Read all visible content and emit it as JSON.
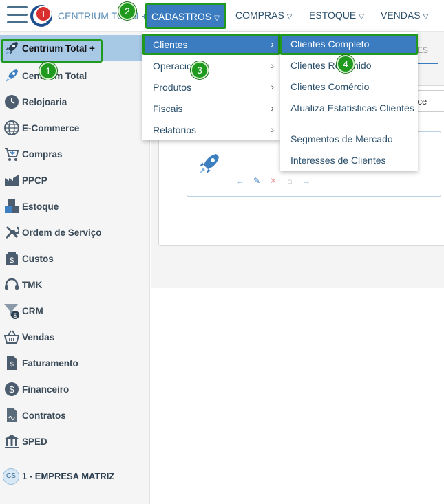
{
  "topbar": {
    "brand": "CENTRIUM TOTAL+",
    "logo_badge": "1",
    "menu": [
      {
        "label": "CADASTROS"
      },
      {
        "label": "COMPRAS"
      },
      {
        "label": "ESTOQUE"
      },
      {
        "label": "VENDAS"
      }
    ]
  },
  "sidebar": {
    "items": [
      {
        "label": "Centrium Total +",
        "icon": "rocket-tag-icon"
      },
      {
        "label": "Centrium Total",
        "icon": "rocket-icon"
      },
      {
        "label": "Relojoaria",
        "icon": "clock-icon"
      },
      {
        "label": "E-Commerce",
        "icon": "globe-icon"
      },
      {
        "label": "Compras",
        "icon": "cart-icon"
      },
      {
        "label": "PPCP",
        "icon": "factory-icon"
      },
      {
        "label": "Estoque",
        "icon": "boxes-icon"
      },
      {
        "label": "Ordem de Serviço",
        "icon": "tools-icon"
      },
      {
        "label": "Custos",
        "icon": "money-box-icon"
      },
      {
        "label": "TMK",
        "icon": "headset-icon"
      },
      {
        "label": "CRM",
        "icon": "funnel-icon"
      },
      {
        "label": "Vendas",
        "icon": "basket-icon"
      },
      {
        "label": "Faturamento",
        "icon": "invoice-icon"
      },
      {
        "label": "Financeiro",
        "icon": "dollar-icon"
      },
      {
        "label": "Contratos",
        "icon": "contract-icon"
      },
      {
        "label": "SPED",
        "icon": "bank-icon"
      }
    ],
    "company": {
      "badge": "CS",
      "label": "1 - EMPRESA MATRIZ"
    }
  },
  "dropdown_cadastros": {
    "items": [
      {
        "label": "Clientes"
      },
      {
        "label": "Operacionais"
      },
      {
        "label": "Produtos"
      },
      {
        "label": "Fiscais"
      },
      {
        "label": "Relatórios"
      }
    ]
  },
  "dropdown_clientes": {
    "items": [
      {
        "label": "Clientes Completo"
      },
      {
        "label": "Clientes Resumido"
      },
      {
        "label": "Clientes Comércio"
      },
      {
        "label": "Atualiza Estatísticas Clientes"
      },
      {
        "label": "Segmentos de Mercado"
      },
      {
        "label": "Interesses de Clientes"
      }
    ]
  },
  "main": {
    "partial_tab": "ES",
    "partial_input": "erce"
  },
  "markers": [
    "1",
    "2",
    "3",
    "4"
  ],
  "colors": {
    "accent": "#3b7bbf",
    "highlight_border": "#1f9a1f",
    "active_row": "#a8c9e6"
  }
}
